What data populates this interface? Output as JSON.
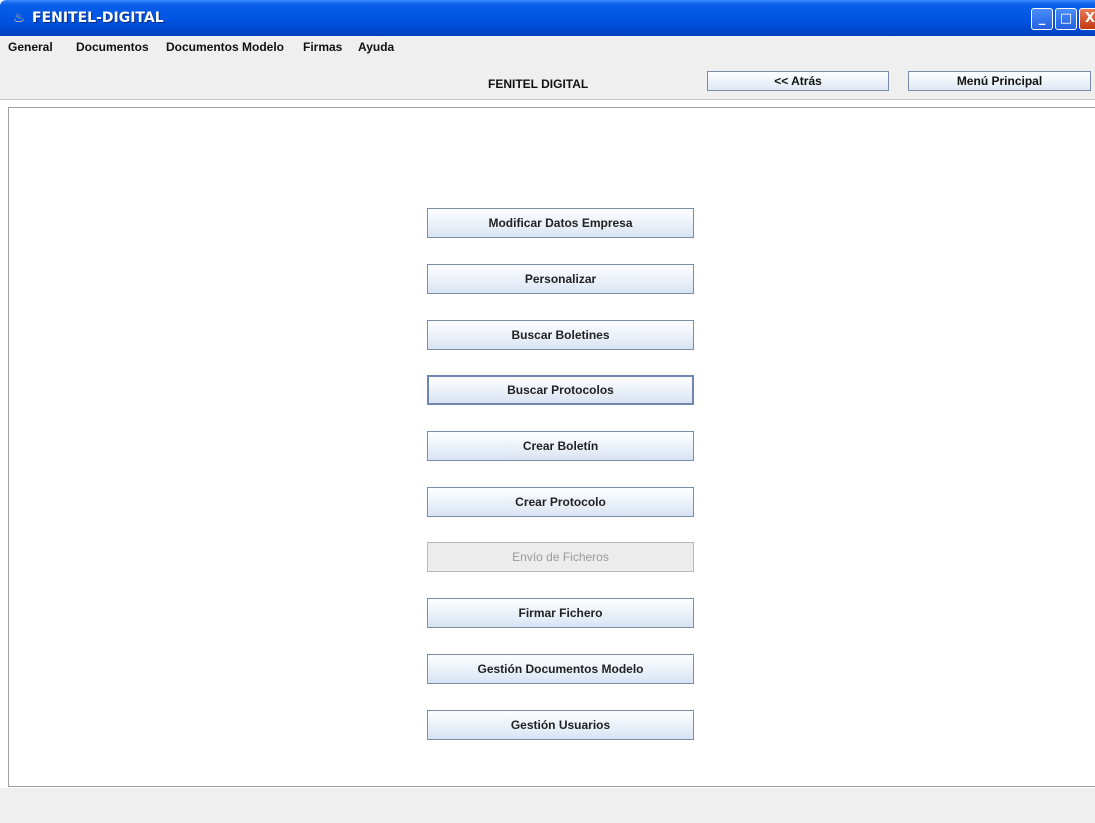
{
  "window": {
    "title": "FENITEL-DIGITAL",
    "icon": "java-cup-icon",
    "controls": {
      "minimize": "_",
      "maximize": "□",
      "close": "X"
    }
  },
  "menubar": {
    "items": [
      {
        "label": "General"
      },
      {
        "label": "Documentos"
      },
      {
        "label": "Documentos Modelo"
      },
      {
        "label": "Firmas"
      },
      {
        "label": "Ayuda"
      }
    ]
  },
  "toolbar": {
    "title": "FENITEL DIGITAL",
    "back_label": "<< Atrás",
    "main_menu_label": "Menú Principal"
  },
  "main_menu": {
    "buttons": [
      {
        "label": "Modificar Datos Empresa",
        "state": "normal"
      },
      {
        "label": "Personalizar",
        "state": "normal"
      },
      {
        "label": "Buscar Boletines",
        "state": "normal"
      },
      {
        "label": "Buscar Protocolos",
        "state": "focused"
      },
      {
        "label": "Crear Boletín",
        "state": "normal"
      },
      {
        "label": "Crear Protocolo",
        "state": "normal"
      },
      {
        "label": "Envío de Ficheros",
        "state": "disabled"
      },
      {
        "label": "Firmar Fichero",
        "state": "normal"
      },
      {
        "label": "Gestión Documentos Modelo",
        "state": "normal"
      },
      {
        "label": "Gestión Usuarios",
        "state": "normal"
      }
    ]
  },
  "colors": {
    "titlebar": "#0055e5",
    "button_border": "#7a8ca6",
    "disabled_text": "#9a9a9a"
  }
}
